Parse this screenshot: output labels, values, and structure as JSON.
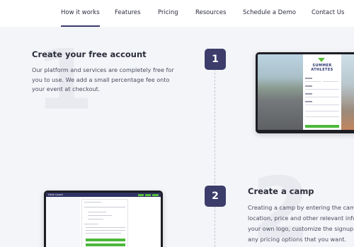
{
  "nav": {
    "items": [
      {
        "label": "How it works",
        "active": true
      },
      {
        "label": "Features"
      },
      {
        "label": "Pricing"
      },
      {
        "label": "Resources"
      },
      {
        "label": "Schedule a Demo"
      },
      {
        "label": "Contact Us"
      }
    ]
  },
  "steps": [
    {
      "number": "1",
      "title": "Create your free account",
      "body": "Our platform and services are completely free for you to use. We add a small percentage fee onto your event at checkout."
    },
    {
      "number": "2",
      "title": "Create a camp",
      "body_lines": [
        "Creating a camp by entering the camp",
        "location, price and other relevant info",
        "your own logo, customize the signup f",
        "any pricing options that you want."
      ]
    }
  ],
  "signup_screen": {
    "logo_top": "SUMMER",
    "logo_bottom": "ATHLETES"
  },
  "dashboard_screen": {
    "title": "Hello Coach"
  },
  "colors": {
    "accent": "#3c3d6b",
    "brand_green": "#5cbf3a",
    "background": "#f4f5f9"
  }
}
